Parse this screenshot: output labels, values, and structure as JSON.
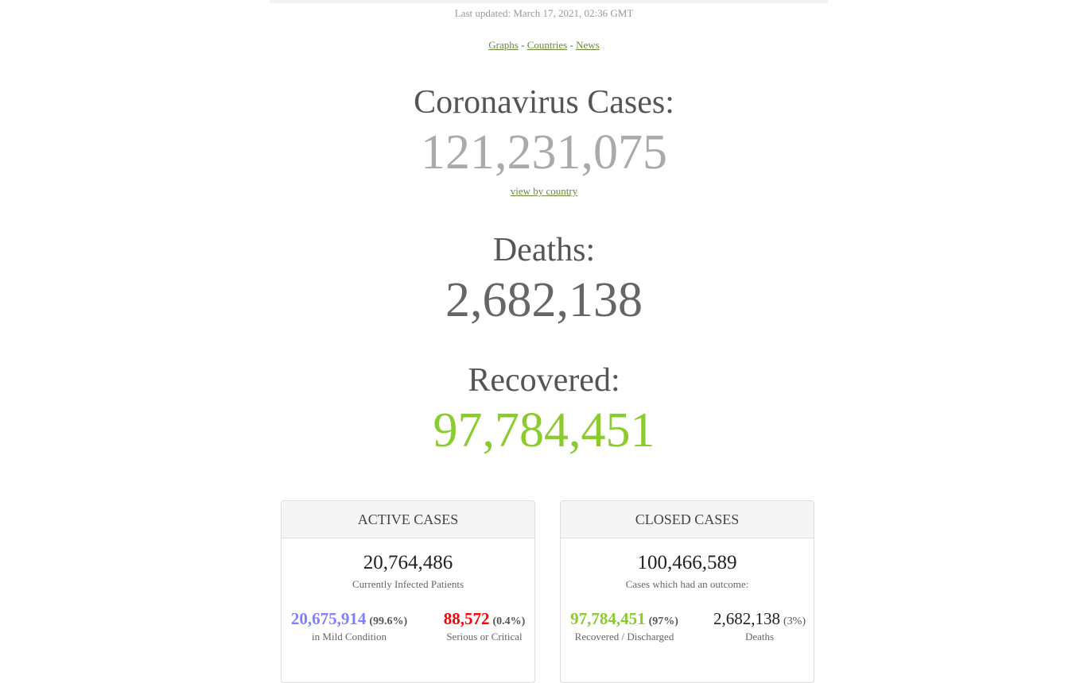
{
  "updated": "Last updated: March 17, 2021, 02:36 GMT",
  "nav": {
    "graphs": "Graphs",
    "countries": "Countries",
    "news": "News",
    "separator": "-"
  },
  "cases": {
    "label": "Coronavirus Cases:",
    "value": "121,231,075",
    "link": "view by country"
  },
  "deaths": {
    "label": "Deaths:",
    "value": "2,682,138"
  },
  "recovered": {
    "label": "Recovered:",
    "value": "97,784,451"
  },
  "active": {
    "title": "ACTIVE CASES",
    "total": "20,764,486",
    "total_label": "Currently Infected Patients",
    "mild_value": "20,675,914",
    "mild_pct": "(99.6%)",
    "mild_label": "in Mild Condition",
    "serious_value": "88,572",
    "serious_pct": "(0.4%)",
    "serious_label": "Serious or Critical"
  },
  "closed": {
    "title": "CLOSED CASES",
    "total": "100,466,589",
    "total_label": "Cases which had an outcome:",
    "recovered_value": "97,784,451",
    "recovered_pct": "(97%)",
    "recovered_label": "Recovered / Discharged",
    "deaths_value": "2,682,138",
    "deaths_pct": "(3%)",
    "deaths_label": "Deaths"
  },
  "colors": {
    "cases": "#aaaaaa",
    "deaths": "#666666",
    "recovered": "#8acb2e",
    "mild": "#8080ff",
    "serious": "#ff0000",
    "closed_recovered": "#8acb2e",
    "closed_deaths": "#222222",
    "link": "#6a8a3a"
  }
}
